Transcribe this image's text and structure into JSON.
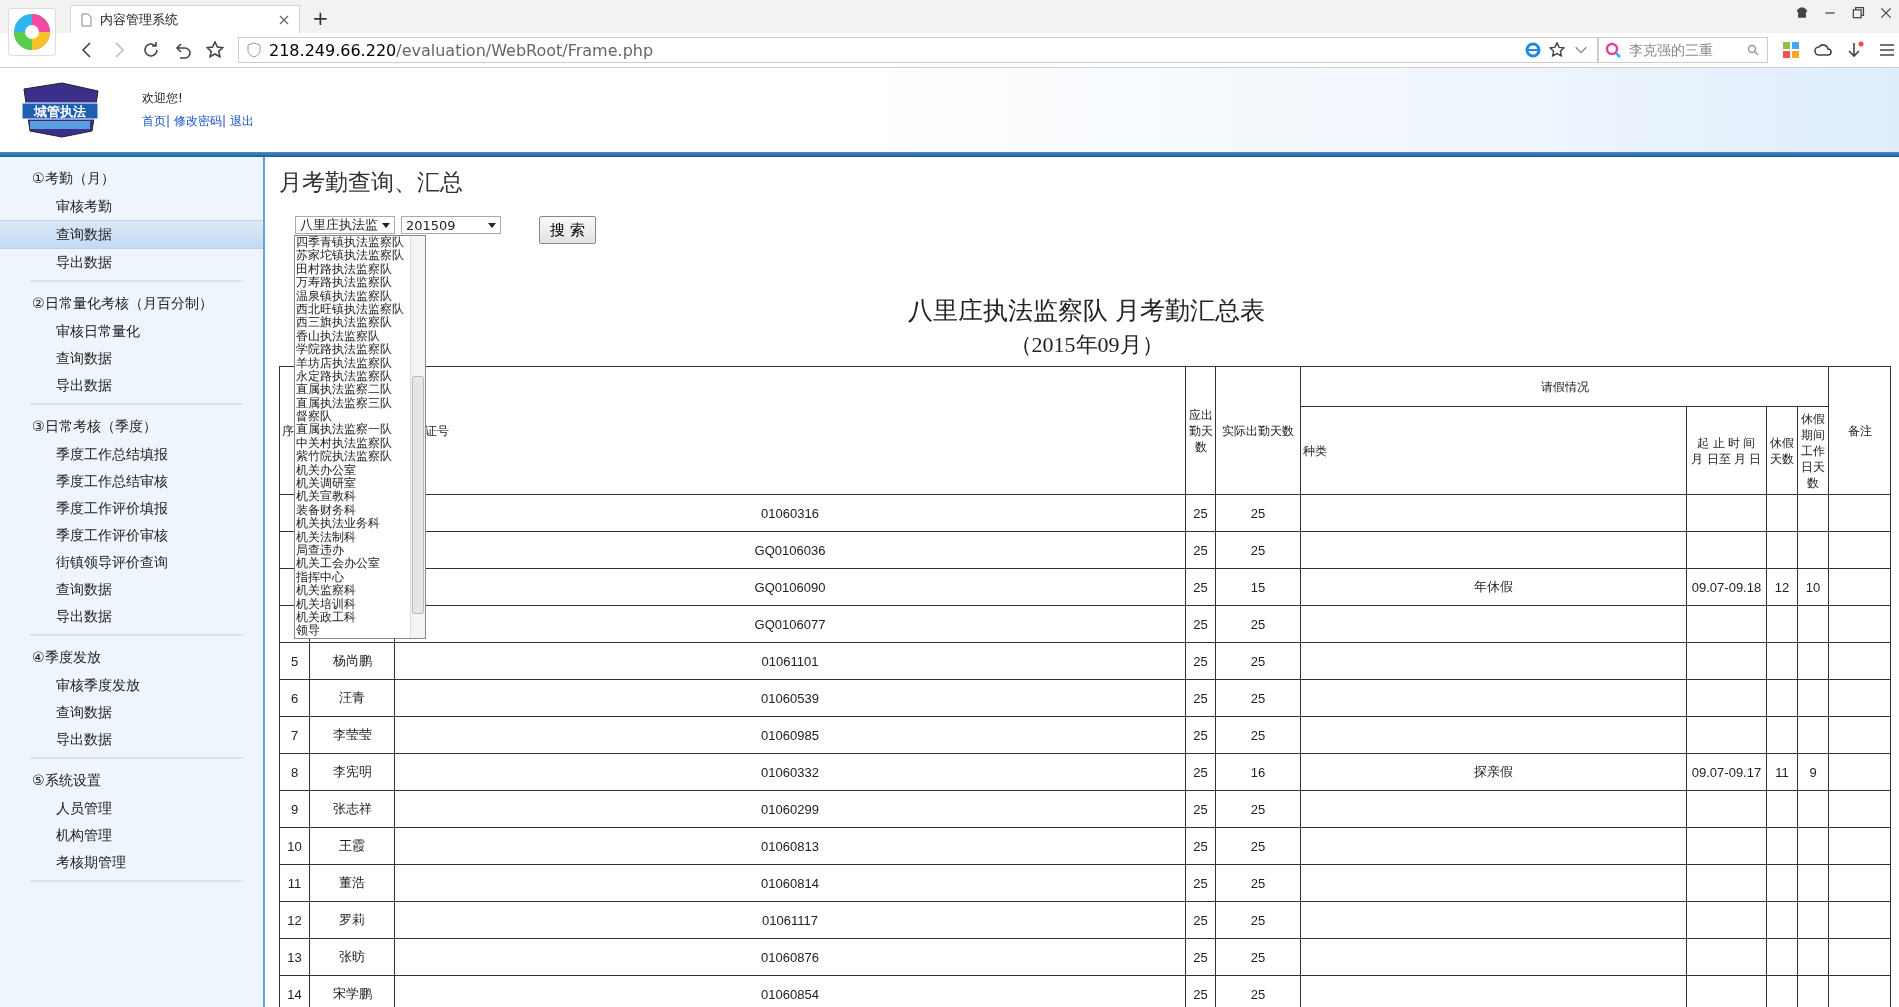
{
  "browser": {
    "tab_title": "内容管理系统",
    "new_tab": "+",
    "url_host": "218.249.66.220",
    "url_path": "/evaluation/WebRoot/Frame.php",
    "search_placeholder": "李克强的三重"
  },
  "header": {
    "logo_text": "城管执法",
    "welcome": "欢迎您!",
    "links": [
      "首页",
      "修改密码",
      "退出"
    ],
    "separator": "|"
  },
  "sidebar": {
    "groups": [
      {
        "title": "①考勤（月）",
        "items": [
          {
            "label": "审核考勤",
            "selected": false
          },
          {
            "label": "查询数据",
            "selected": true
          },
          {
            "label": "导出数据",
            "selected": false
          }
        ]
      },
      {
        "title": "②日常量化考核（月百分制）",
        "items": [
          {
            "label": "审核日常量化",
            "selected": false
          },
          {
            "label": "查询数据",
            "selected": false
          },
          {
            "label": "导出数据",
            "selected": false
          }
        ]
      },
      {
        "title": "③日常考核（季度）",
        "items": [
          {
            "label": "季度工作总结填报",
            "selected": false
          },
          {
            "label": "季度工作总结审核",
            "selected": false
          },
          {
            "label": "季度工作评价填报",
            "selected": false
          },
          {
            "label": "季度工作评价审核",
            "selected": false
          },
          {
            "label": "街镇领导评价查询",
            "selected": false
          },
          {
            "label": "查询数据",
            "selected": false
          },
          {
            "label": "导出数据",
            "selected": false
          }
        ]
      },
      {
        "title": "④季度发放",
        "items": [
          {
            "label": "审核季度发放",
            "selected": false
          },
          {
            "label": "查询数据",
            "selected": false
          },
          {
            "label": "导出数据",
            "selected": false
          }
        ]
      },
      {
        "title": "⑤系统设置",
        "items": [
          {
            "label": "人员管理",
            "selected": false
          },
          {
            "label": "机构管理",
            "selected": false
          },
          {
            "label": "考核期管理",
            "selected": false
          }
        ]
      }
    ]
  },
  "page_title": "月考勤查询、汇总",
  "filters": {
    "unit_select": "八里庄执法监",
    "month_select": "201509",
    "search_button": "搜 索",
    "unit_options": [
      "四季青镇执法监察队",
      "苏家坨镇执法监察队",
      "田村路执法监察队",
      "万寿路执法监察队",
      "温泉镇执法监察队",
      "西北旺镇执法监察队",
      "西三旗执法监察队",
      "香山执法监察队",
      "学院路执法监察队",
      "羊坊店执法监察队",
      "永定路执法监察队",
      "直属执法监察二队",
      "直属执法监察三队",
      "督察队",
      "直属执法监察一队",
      "中关村执法监察队",
      "紫竹院执法监察队",
      "机关办公室",
      "机关调研室",
      "机关宣教科",
      "装备财务科",
      "机关执法业务科",
      "机关法制科",
      "局查违办",
      "机关工会办公室",
      "指挥中心",
      "机关监察科",
      "机关培训科",
      "机关政工科",
      "领导"
    ]
  },
  "report": {
    "title": "八里庄执法监察队  月考勤汇总表",
    "subtitle": "（2015年09月）",
    "header": {
      "index": "序",
      "id": "证号",
      "due": "应出勤天数",
      "actual": "实际出勤天数",
      "leave": "请假情况",
      "type": "种类",
      "period": [
        "起 止 时 间",
        "月 日至 月 日"
      ],
      "days": "休假天数",
      "workdays": "休假期间工作日天数",
      "remark": "备注"
    },
    "rows": [
      {
        "id": "01060316",
        "due": "25",
        "actual": "25"
      },
      {
        "id": "GQ0106036",
        "due": "25",
        "actual": "25"
      },
      {
        "id": "GQ0106090",
        "due": "25",
        "actual": "15",
        "type": "年休假",
        "period": "09.07-09.18",
        "days": "12",
        "workdays": "10"
      },
      {
        "id": "GQ0106077",
        "due": "25",
        "actual": "25"
      },
      {
        "index": "5",
        "name": "杨尚鹏",
        "id": "01061101",
        "due": "25",
        "actual": "25"
      },
      {
        "index": "6",
        "name": "汪青",
        "id": "01060539",
        "due": "25",
        "actual": "25"
      },
      {
        "index": "7",
        "name": "李莹莹",
        "id": "01060985",
        "due": "25",
        "actual": "25"
      },
      {
        "index": "8",
        "name": "李宪明",
        "id": "01060332",
        "due": "25",
        "actual": "16",
        "type": "探亲假",
        "period": "09.07-09.17",
        "days": "11",
        "workdays": "9"
      },
      {
        "index": "9",
        "name": "张志祥",
        "id": "01060299",
        "due": "25",
        "actual": "25"
      },
      {
        "index": "10",
        "name": "王霞",
        "id": "01060813",
        "due": "25",
        "actual": "25"
      },
      {
        "index": "11",
        "name": "董浩",
        "id": "01060814",
        "due": "25",
        "actual": "25"
      },
      {
        "index": "12",
        "name": "罗莉",
        "id": "01061117",
        "due": "25",
        "actual": "25"
      },
      {
        "index": "13",
        "name": "张昉",
        "id": "01060876",
        "due": "25",
        "actual": "25"
      },
      {
        "index": "14",
        "name": "宋学鹏",
        "id": "01060854",
        "due": "25",
        "actual": "25"
      }
    ]
  }
}
